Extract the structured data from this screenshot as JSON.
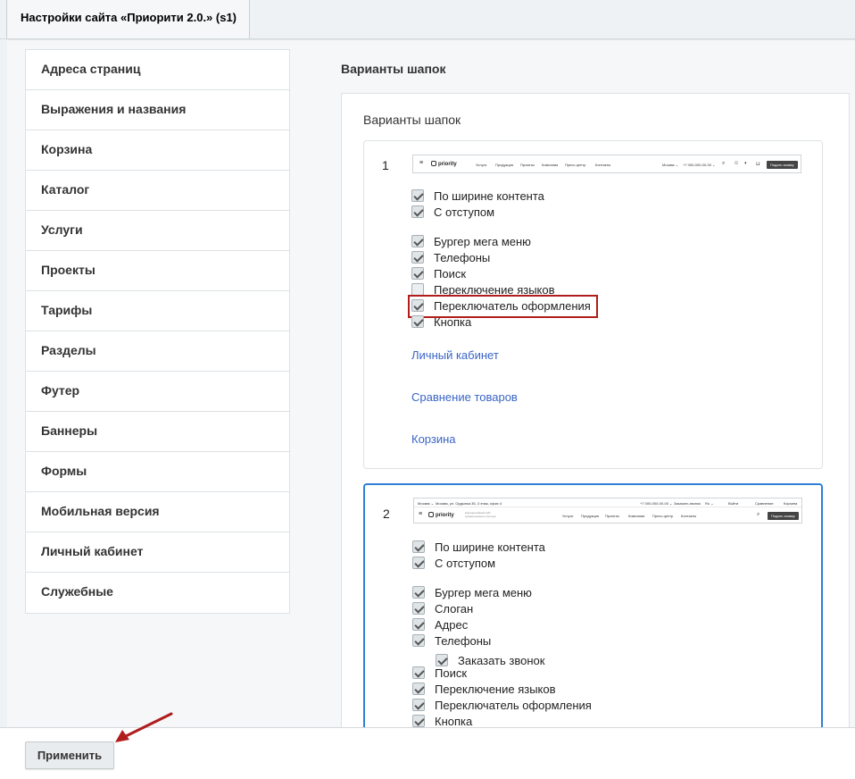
{
  "tab": {
    "title": "Настройки сайта «Приорити 2.0.» (s1)"
  },
  "sidebar": {
    "items": [
      "Адреса страниц",
      "Выражения и названия",
      "Корзина",
      "Каталог",
      "Услуги",
      "Проекты",
      "Тарифы",
      "Разделы",
      "Футер",
      "Баннеры",
      "Формы",
      "Мобильная версия",
      "Личный кабинет",
      "Служебные"
    ]
  },
  "main": {
    "section_title": "Варианты шапок",
    "panel_title": "Варианты шапок",
    "cards": [
      {
        "number": "1",
        "preview": {
          "logo": "priority",
          "menu": [
            "Услуги",
            "Продукция",
            "Проекты",
            "Компания",
            "Пресс-центр",
            "Контакты"
          ],
          "city": "Москва ⌄",
          "phone": "+7 000-000-00-00 ⌄",
          "button": "Подать заявку"
        },
        "options": [
          {
            "label": "По ширине контента",
            "checked": true
          },
          {
            "label": "С отступом",
            "checked": true
          },
          {
            "label": "Бургер мега меню",
            "checked": true
          },
          {
            "label": "Телефоны",
            "checked": true
          },
          {
            "label": "Поиск",
            "checked": true
          },
          {
            "label": "Переключение языков",
            "checked": false
          },
          {
            "label": "Переключатель оформления",
            "checked": true,
            "highlighted": true
          },
          {
            "label": "Кнопка",
            "checked": true
          }
        ],
        "links": [
          "Личный кабинет",
          "Сравнение товаров",
          "Корзина"
        ]
      },
      {
        "number": "2",
        "preview": {
          "top_city": "Москва ⌄",
          "top_address": "Москва, ул. Ордынка 35, 3 этаж, офис 4",
          "top_phone": "+7 000-000-00-00 ⌄",
          "top_call": "Заказать звонок",
          "top_lang": "Ru ⌄",
          "top_login": "Войти",
          "top_compare": "Сравнение",
          "top_cart": "Корзина",
          "logo": "priority",
          "slogan": "Корпоративный сайт промышленного сектора",
          "menu": [
            "Услуги",
            "Продукция",
            "Проекты",
            "Компания",
            "Пресс-центр",
            "Контакты"
          ],
          "button": "Подать заявку"
        },
        "options": [
          {
            "label": "По ширине контента",
            "checked": true
          },
          {
            "label": "С отступом",
            "checked": true
          },
          {
            "label": "Бургер мега меню",
            "checked": true
          },
          {
            "label": "Слоган",
            "checked": true
          },
          {
            "label": "Адрес",
            "checked": true
          },
          {
            "label": "Телефоны",
            "checked": true
          },
          {
            "label": "Заказать звонок",
            "checked": true
          },
          {
            "label": "Поиск",
            "checked": true
          },
          {
            "label": "Переключение языков",
            "checked": true
          },
          {
            "label": "Переключатель оформления",
            "checked": true
          },
          {
            "label": "Кнопка",
            "checked": true
          }
        ]
      }
    ]
  },
  "footer": {
    "apply_label": "Применить"
  },
  "colors": {
    "selected_border": "#2e7fd6",
    "highlight": "#b11c1c",
    "link": "#3a65c5",
    "annotation_arrow": "#b11c1c"
  }
}
